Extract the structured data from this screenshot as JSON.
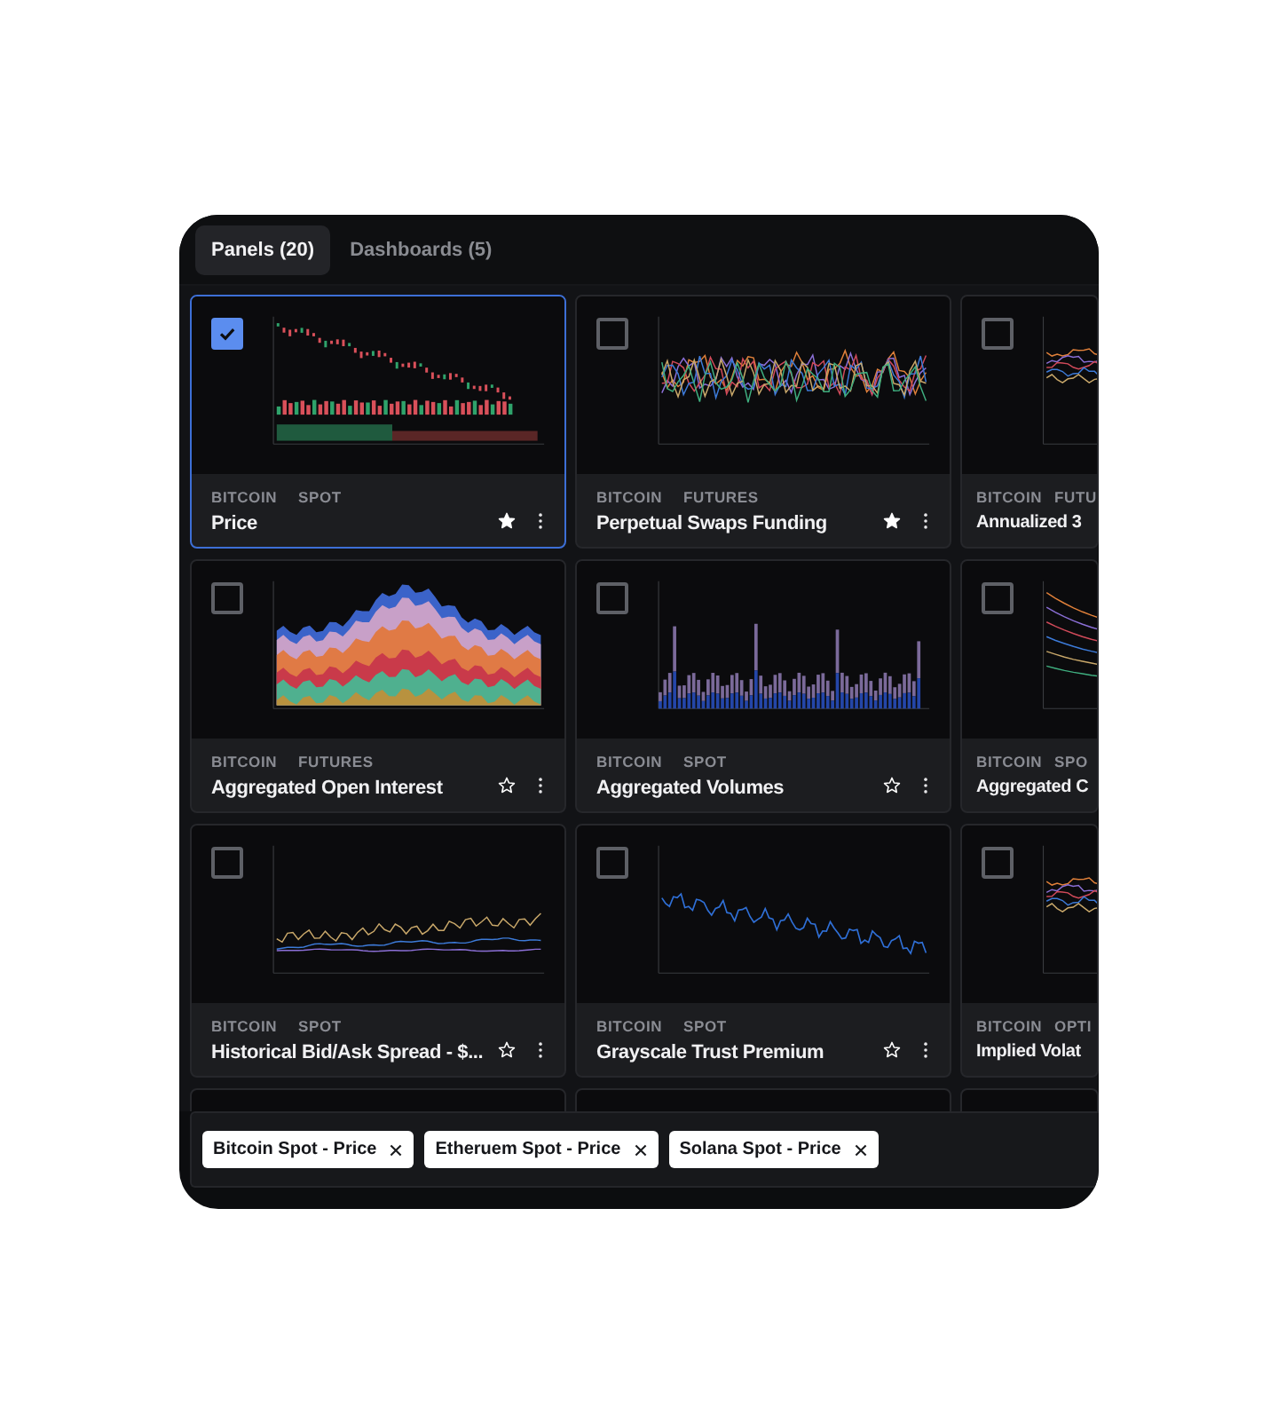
{
  "tabs": [
    {
      "label": "Panels (20)",
      "selected": true
    },
    {
      "label": "Dashboards (5)",
      "selected": false
    }
  ],
  "cards": [
    {
      "tags": [
        "BITCOIN",
        "SPOT"
      ],
      "title": "Price",
      "selected": true,
      "starred": true,
      "kind": "candles"
    },
    {
      "tags": [
        "BITCOIN",
        "FUTURES"
      ],
      "title": "Perpetual Swaps Funding",
      "selected": false,
      "starred": true,
      "kind": "multi-line"
    },
    {
      "tags": [
        "BITCOIN",
        "FUTU"
      ],
      "title": "Annualized 3",
      "selected": false,
      "kind": "band-lines"
    },
    {
      "tags": [
        "BITCOIN",
        "FUTURES"
      ],
      "title": "Aggregated Open Interest",
      "selected": false,
      "starred": false,
      "kind": "area"
    },
    {
      "tags": [
        "BITCOIN",
        "SPOT"
      ],
      "title": "Aggregated Volumes",
      "selected": false,
      "starred": false,
      "kind": "bars"
    },
    {
      "tags": [
        "BITCOIN",
        "SPO"
      ],
      "title": "Aggregated C",
      "selected": false,
      "kind": "decay-lines"
    },
    {
      "tags": [
        "BITCOIN",
        "SPOT"
      ],
      "title": "Historical Bid/Ask Spread - $...",
      "selected": false,
      "starred": false,
      "kind": "spiky-lines"
    },
    {
      "tags": [
        "BITCOIN",
        "SPOT"
      ],
      "title": "Grayscale Trust Premium",
      "selected": false,
      "starred": false,
      "kind": "single-line"
    },
    {
      "tags": [
        "BITCOIN",
        "OPTI"
      ],
      "title": "Implied Volat",
      "selected": false,
      "kind": "band-lines"
    }
  ],
  "selection": [
    {
      "label": "Bitcoin Spot - Price"
    },
    {
      "label": "Etheruem Spot - Price"
    },
    {
      "label": "Solana Spot - Price"
    }
  ]
}
